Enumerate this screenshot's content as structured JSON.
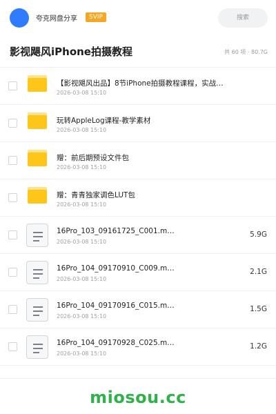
{
  "header": {
    "brand": "夸克网盘分享",
    "badge": "SVIP",
    "search_label": "搜索",
    "brand_color": "#2f7cff"
  },
  "page": {
    "title": "影视飓风iPhone拍摄教程",
    "meta": "共 60 项 · 80.7G"
  },
  "files": [
    {
      "type": "folder",
      "name": "【影视飓风出品】8节iPhone拍摄教程课程，实战…",
      "date": "2026-03-08 15:10",
      "size": ""
    },
    {
      "type": "folder",
      "name": "玩转AppleLog课程-教学素材",
      "date": "2026-03-08 15:10",
      "size": ""
    },
    {
      "type": "folder",
      "name": "赠：前后期预设文件包",
      "date": "2026-03-08 15:10",
      "size": ""
    },
    {
      "type": "folder",
      "name": "赠：青青独家调色LUT包",
      "date": "2026-03-08 15:10",
      "size": ""
    },
    {
      "type": "file",
      "name": "16Pro_103_09161725_C001.m…",
      "date": "2026-03-08 15:10",
      "size": "5.9G"
    },
    {
      "type": "file",
      "name": "16Pro_104_09170910_C009.m…",
      "date": "2026-03-08 15:10",
      "size": "2.1G"
    },
    {
      "type": "file",
      "name": "16Pro_104_09170916_C015.m…",
      "date": "2026-03-08 15:10",
      "size": "1.5G"
    },
    {
      "type": "file",
      "name": "16Pro_104_09170928_C025.m…",
      "date": "2026-03-08 15:10",
      "size": "1.2G"
    }
  ],
  "watermark": "miosou.cc",
  "icons": {
    "folder": "folder-icon",
    "file": "document-icon",
    "checkbox": "checkbox"
  }
}
